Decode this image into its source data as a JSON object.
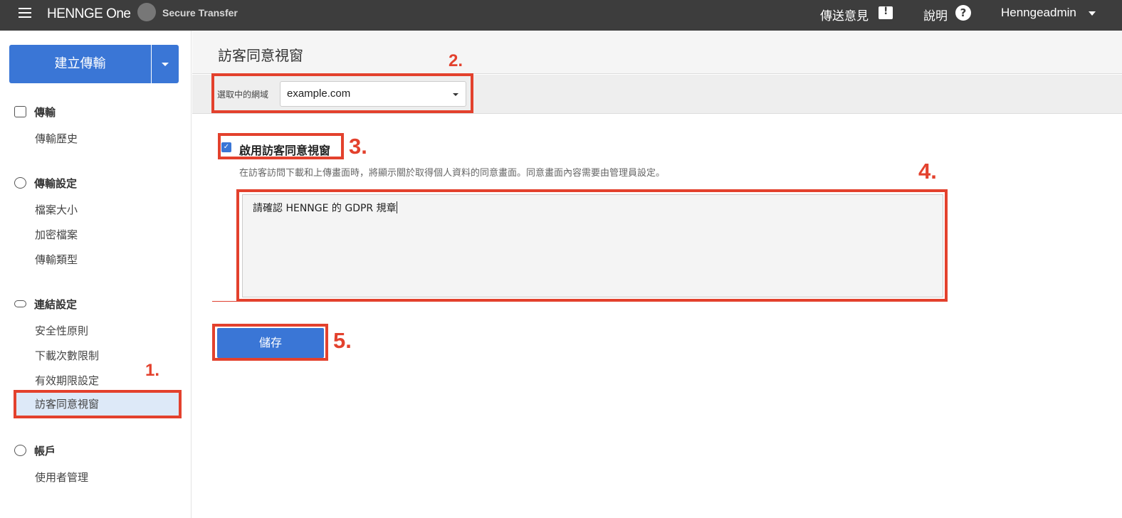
{
  "topbar": {
    "logo": "HENNGE One",
    "product": "Secure Transfer",
    "feedback_label": "傳送意見",
    "help_label": "說明",
    "help_icon": "?",
    "user_label": "Henngeadmin"
  },
  "sidebar": {
    "create_button": "建立傳輸",
    "sections": [
      {
        "title": "傳輸",
        "items": [
          "傳輸歷史"
        ]
      },
      {
        "title": "傳輸設定",
        "items": [
          "檔案大小",
          "加密檔案",
          "傳輸類型"
        ]
      },
      {
        "title": "連結設定",
        "items": [
          "安全性原則",
          "下載次數限制",
          "有效期限設定",
          "訪客同意視窗"
        ]
      },
      {
        "title": "帳戶",
        "items": [
          "使用者管理"
        ]
      }
    ]
  },
  "main": {
    "title": "訪客同意視窗",
    "domain_label": "選取中的網域",
    "domain_value": "example.com",
    "checkbox_label": "啟用訪客同意視窗",
    "help_text": "在訪客訪問下載和上傳畫面時，將顯示關於取得個人資料的同意畫面。同意畫面內容需要由管理員設定。",
    "consent_text": "請確認 HENNGE 的 GDPR 規章",
    "save_button": "儲存"
  },
  "annotations": [
    "1.",
    "2.",
    "3.",
    "4.",
    "5."
  ],
  "colors": {
    "accent": "#3a76d6",
    "annotation": "#e3412d",
    "topbar": "#3d3d3d"
  }
}
